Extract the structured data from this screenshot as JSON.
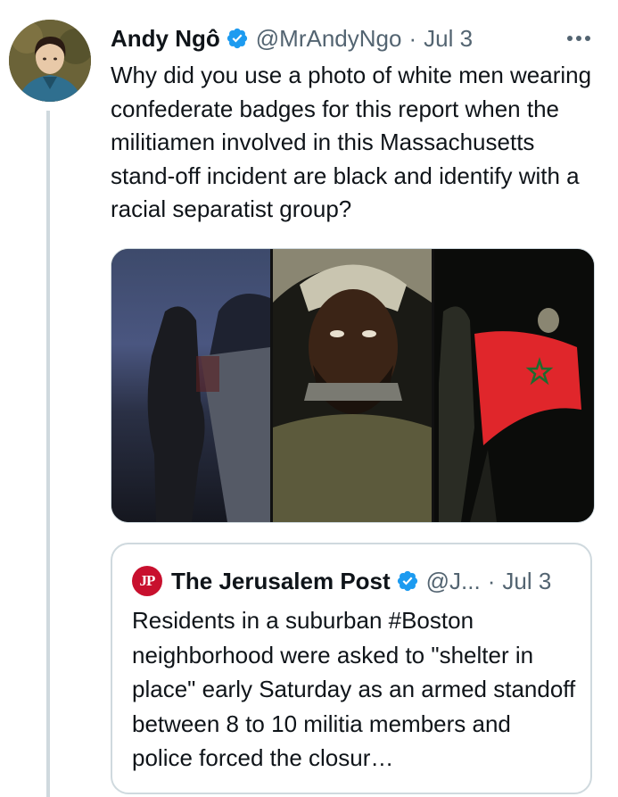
{
  "tweet": {
    "author_name": "Andy Ngô",
    "handle": "@MrAndyNgo",
    "separator": "·",
    "date": "Jul 3",
    "text": "Why did you use a photo of white men wearing confederate badges for this report when the militiamen involved in this Massachusetts stand-off incident are black and identify with a racial separatist group?",
    "verified_icon": "verified-badge-icon",
    "more_icon": "more-options-icon",
    "media": [
      {
        "alt_icon": "photo-night-road"
      },
      {
        "alt_icon": "photo-man-helmet"
      },
      {
        "alt_icon": "photo-flag-night"
      }
    ]
  },
  "quoted_tweet": {
    "logo_text": "JP",
    "author_name": "The Jerusalem Post",
    "handle": "@J...",
    "separator": "·",
    "date": "Jul 3",
    "text": "Residents in a suburban #Boston neighborhood were asked to \"shelter in place\" early Saturday as an armed standoff between 8 to 10 militia members and police forced the closur…"
  },
  "colors": {
    "verified": "#1d9bf0",
    "secondary_text": "#536471",
    "border": "#cfd9de",
    "jpost_red": "#c8102e",
    "flag_red": "#e0262b",
    "flag_star": "#1e6b2e"
  }
}
